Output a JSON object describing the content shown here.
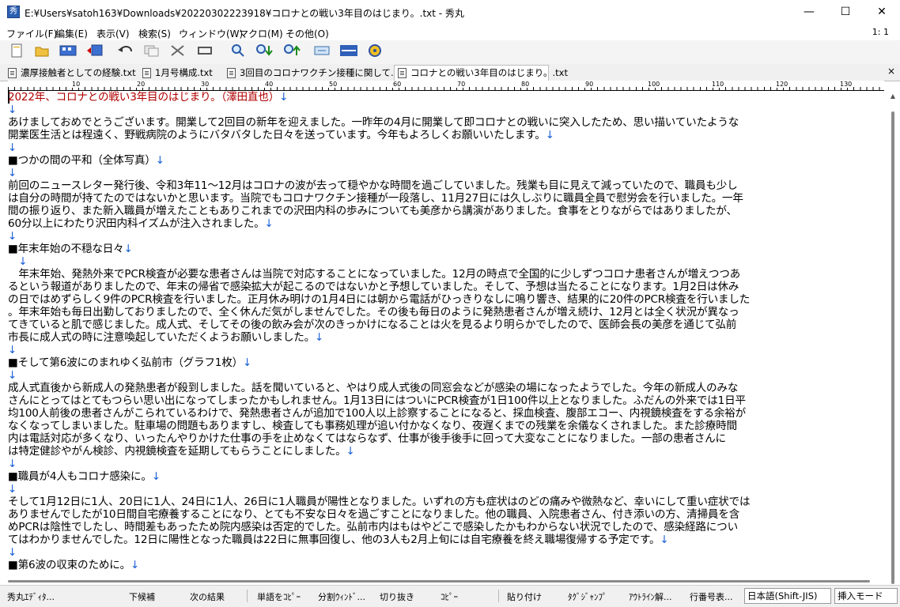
{
  "window": {
    "title": "E:¥Users¥satoh163¥Downloads¥20220302223918¥コロナとの戦い3年目のはじまり。.txt - 秀丸",
    "minimize": "—",
    "maximize": "☐",
    "close": "✕"
  },
  "menu": {
    "items": [
      "ファイル(F)",
      "編集(E)",
      "表示(V)",
      "検索(S)",
      "ウィンドウ(W)",
      "マクロ(M)",
      "その他(O)"
    ],
    "position": "1: 1"
  },
  "toolbar": {
    "icons": [
      "new-file-icon",
      "open-folder-icon",
      "save-all-icon",
      "save-as-icon",
      "undo-icon",
      "copy-icon",
      "cut-icon",
      "paste-icon",
      "search-icon",
      "search-next-icon",
      "search-prev-icon",
      "tag-jump-icon",
      "split-window-icon",
      "macro-icon"
    ]
  },
  "tabs": [
    {
      "label": "濃厚接触者としての経験.txt",
      "active": false
    },
    {
      "label": "1月号構成.txt",
      "active": false
    },
    {
      "label": "3回目のコロナワクチン接種に関して.txt",
      "active": false
    },
    {
      "label": "コロナとの戦い3年目のはじまり。.txt",
      "active": true
    }
  ],
  "tabs_close": "×",
  "ruler": {
    "marks": [
      "10",
      "20",
      "30",
      "40",
      "50",
      "60",
      "70",
      "80",
      "90",
      "100",
      "110",
      "120",
      "130"
    ]
  },
  "document": {
    "lines": [
      {
        "text": "2022年、コロナとの戦い3年目のはじまり。（澤田直也）",
        "eol": "↓",
        "heading": true
      },
      {
        "text": "",
        "eol": "↓"
      },
      {
        "text": "あけましておめでとうございます。開業して2回目の新年を迎えました。一昨年の4月に開業して即コロナとの戦いに突入したため、思い描いていたような",
        "eol": ""
      },
      {
        "text": "開業医生活とは程遠く、野戦病院のようにバタバタした日々を送っています。今年もよろしくお願いいたします。",
        "eol": "↓"
      },
      {
        "text": "",
        "eol": "↓"
      },
      {
        "text": "■つかの間の平和（全体写真）",
        "eol": "↓"
      },
      {
        "text": "",
        "eol": "↓"
      },
      {
        "text": "前回のニュースレター発行後、令和3年11～12月はコロナの波が去って穏やかな時間を過ごしていました。残業も目に見えて減っていたので、職員も少し",
        "eol": ""
      },
      {
        "text": "は自分の時間が持てたのではないかと思います。当院でもコロナワクチン接種が一段落し、11月27日には久しぶりに職員全員で慰労会を行いました。一年",
        "eol": ""
      },
      {
        "text": "間の振り返り、また新入職員が増えたこともありこれまでの沢田内科の歩みについても美彦から講演がありました。食事をとりながらではありましたが、",
        "eol": ""
      },
      {
        "text": "60分以上にわたり沢田内科イズムが注入されました。",
        "eol": "↓"
      },
      {
        "text": "",
        "eol": "↓"
      },
      {
        "text": "■年末年始の不穏な日々",
        "eol": "↓"
      },
      {
        "text": "　",
        "eol": "↓"
      },
      {
        "text": "　年末年始、発熱外来でPCR検査が必要な患者さんは当院で対応することになっていました。12月の時点で全国的に少しずつコロナ患者さんが増えつつあ",
        "eol": ""
      },
      {
        "text": "るという報道がありましたので、年末の帰省で感染拡大が起こるのではないかと予想していました。そして、予想は当たることになります。1月2日は休み",
        "eol": ""
      },
      {
        "text": "の日ではめずらしく9件のPCR検査を行いました。正月休み明けの1月4日には朝から電話がひっきりなしに鳴り響き、結果的に20件のPCR検査を行いました",
        "eol": ""
      },
      {
        "text": "。年末年始も毎日出勤しておりましたので、全く休んだ気がしませんでした。その後も毎日のように発熱患者さんが増え続け、12月とは全く状況が異なっ",
        "eol": ""
      },
      {
        "text": "てきていると肌で感じました。成人式、そしてその後の飲み会が次のきっかけになることは火を見るより明らかでしたので、医師会長の美彦を通じて弘前",
        "eol": ""
      },
      {
        "text": "市長に成人式の時に注意喚起していただくようお願いしました。",
        "eol": "↓"
      },
      {
        "text": "",
        "eol": "↓"
      },
      {
        "text": "■そして第6波にのまれゆく弘前市（グラフ1枚）",
        "eol": "↓"
      },
      {
        "text": "",
        "eol": "↓"
      },
      {
        "text": "成人式直後から新成人の発熱患者が殺到しました。話を聞いていると、やはり成人式後の同窓会などが感染の場になったようでした。今年の新成人のみな",
        "eol": ""
      },
      {
        "text": "さんにとってはとてもつらい思い出になってしまったかもしれません。1月13日にはついにPCR検査が1日100件以上となりました。ふだんの外来では1日平",
        "eol": ""
      },
      {
        "text": "均100人前後の患者さんがこられているわけで、発熱患者さんが追加で100人以上診察することになると、採血検査、腹部エコー、内視鏡検査をする余裕が",
        "eol": ""
      },
      {
        "text": "なくなってしまいました。駐車場の問題もありますし、検査しても事務処理が追い付かなくなり、夜遅くまでの残業を余儀なくされました。また診療時間",
        "eol": ""
      },
      {
        "text": "内は電話対応が多くなり、いったんやりかけた仕事の手を止めなくてはならなず、仕事が後手後手に回って大変なことになりました。一部の患者さんに",
        "eol": ""
      },
      {
        "text": "は特定健診やがん検診、内視鏡検査を延期してもらうことにしました。",
        "eol": "↓"
      },
      {
        "text": "",
        "eol": "↓"
      },
      {
        "text": "■職員が4人もコロナ感染に。",
        "eol": "↓"
      },
      {
        "text": "",
        "eol": "↓"
      },
      {
        "text": "そして1月12日に1人、20日に1人、24日に1人、26日に1人職員が陽性となりました。いずれの方も症状はのどの痛みや微熱など、幸いにして重い症状では",
        "eol": ""
      },
      {
        "text": "ありませんでしたが10日間自宅療養することになり、とても不安な日々を過ごすことになりました。他の職員、入院患者さん、付き添いの方、清掃員を含",
        "eol": ""
      },
      {
        "text": "めPCRは陰性でしたし、時間差もあったため院内感染は否定的でした。弘前市内はもはやどこで感染したかもわからない状況でしたので、感染経路につい",
        "eol": ""
      },
      {
        "text": "てはわかりませんでした。12日に陽性となった職員は22日に無事回復し、他の3人も2月上旬には自宅療養を終え職場復帰する予定です。",
        "eol": "↓"
      },
      {
        "text": "",
        "eol": "↓"
      },
      {
        "text": "■第6波の収束のために。",
        "eol": "↓"
      }
    ]
  },
  "status": {
    "items": [
      "秀丸ｴﾃﾞｨﾀ...",
      "下候補",
      "次の結果",
      "単語をｺﾋﾟｰ",
      "分割ｳｨﾝﾄﾞ...",
      "切り抜き",
      "ｺﾋﾟｰ",
      "貼り付け",
      "ﾀｸﾞｼﾞｬﾝﾌﾟ",
      "ｱｳﾄﾗｲﾝ解...",
      "行番号表..."
    ],
    "encoding": "日本語(Shift-JIS)",
    "mode": "挿入モード"
  }
}
